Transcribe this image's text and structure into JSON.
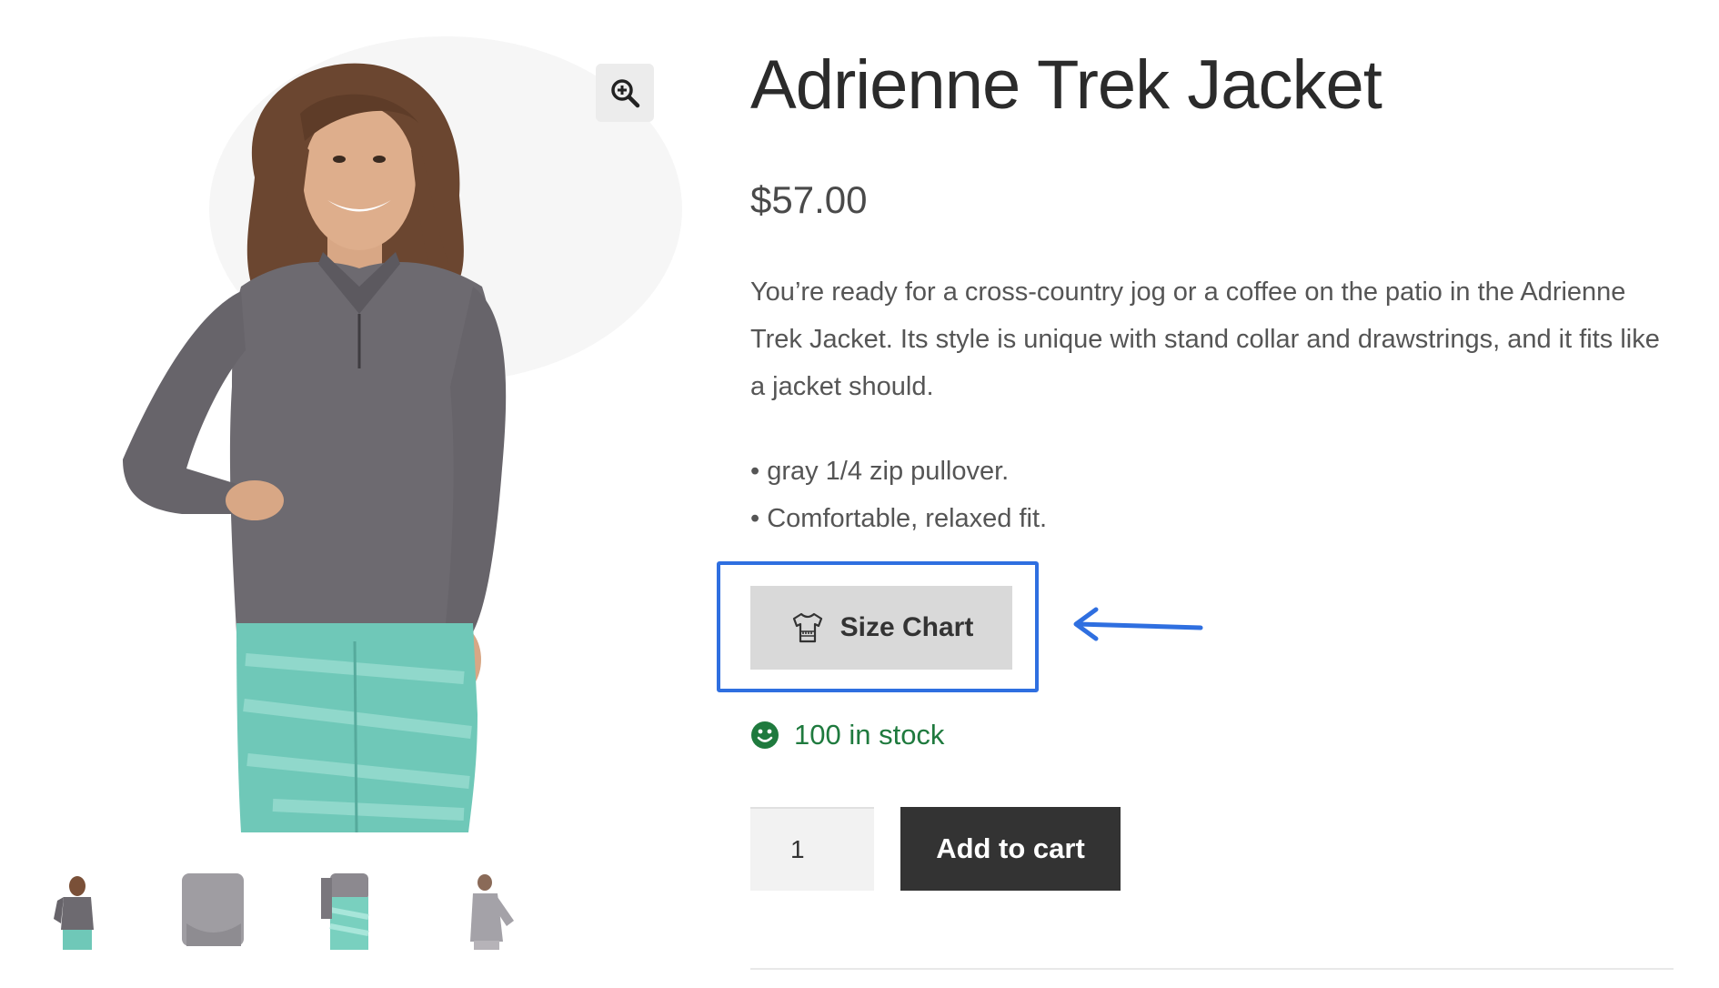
{
  "product": {
    "title": "Adrienne Trek Jacket",
    "price": "$57.00",
    "description": "You’re ready for a cross-country jog or a coffee on the patio in the Adrienne Trek Jacket. Its style is unique with stand collar and drawstrings, and it fits like a jacket should.",
    "bullets": [
      "• gray 1/4 zip pullover.",
      "• Comfortable, relaxed fit."
    ],
    "size_chart_label": "Size Chart",
    "stock_text": "100 in stock",
    "quantity": "1",
    "add_to_cart_label": "Add to cart"
  },
  "icons": {
    "zoom": "zoom-in-icon",
    "size_chart": "tshirt-icon",
    "stock": "smiley-icon",
    "annotation": "arrow-left-icon"
  },
  "colors": {
    "highlight": "#2f6fe0",
    "stock": "#1f7a3e",
    "button_dark": "#333333",
    "size_chart_bg": "#d9d9d9"
  }
}
